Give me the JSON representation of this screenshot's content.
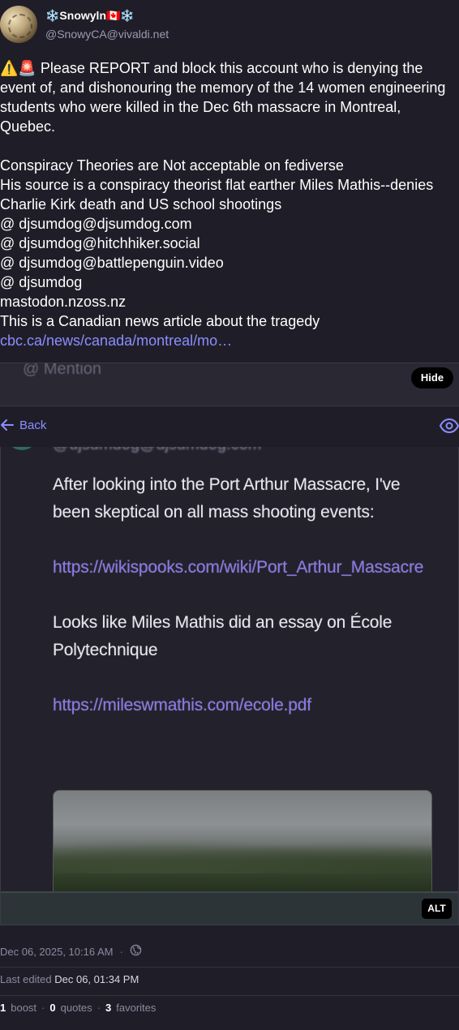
{
  "author": {
    "display_name": "❄️Snowyln🇨🇦❄️",
    "handle": "@SnowyCA@vivaldi.net"
  },
  "post": {
    "paragraph1": "⚠️🚨  Please REPORT  and block this  account who is denying the event of,   and dishonouring the memory of the 14 women engineering students who were killed in the Dec 6th massacre in Montreal, Quebec.",
    "line1": "Conspiracy Theories are Not acceptable on fediverse",
    "line2": "His source is  a conspiracy theorist  flat earther Miles Mathis--denies Charlie Kirk death and US school shootings",
    "line3": "@ djsumdog@djsumdog.com",
    "line4": "@ djsumdog@hitchhiker.social",
    "line5": "@ djsumdog@battlepenguin.video",
    "line6": "@ djsumdog",
    "line7": "mastodon.nzoss.nz",
    "line8_prefix": "This is a Canadian news article about the tragedy ",
    "line8_link": "cbc.ca/news/canada/montreal/mo…"
  },
  "media_top": {
    "mention_text": "@  Mention",
    "hide_label": "Hide"
  },
  "nav": {
    "back_label": "Back"
  },
  "screenshot": {
    "handle_blur": "@djsumdog@djsumdog.com",
    "text1": "After looking into the Port Arthur Massacre, I've been skeptical on all mass shooting events:",
    "link1": "https://wikispooks.com/wiki/Port_Arthur_Massacre",
    "text2": "Looks like Miles Mathis did an essay on École Polytechnique",
    "link2": "https://mileswmathis.com/ecole.pdf",
    "alt_label": "ALT"
  },
  "meta": {
    "date": "Dec 06, 2025, 10:16 AM",
    "dot": "·",
    "edited_label": "Last edited",
    "edited_date": "Dec 06, 01:34 PM",
    "boosts": "1",
    "boosts_label": "boost",
    "quotes": "0",
    "quotes_label": "quotes",
    "favorites": "3",
    "favorites_label": "favorites"
  },
  "colors": {
    "background": "#1f1e28",
    "accent_link": "#8c8dff",
    "muted_text": "#8a8aa0"
  }
}
